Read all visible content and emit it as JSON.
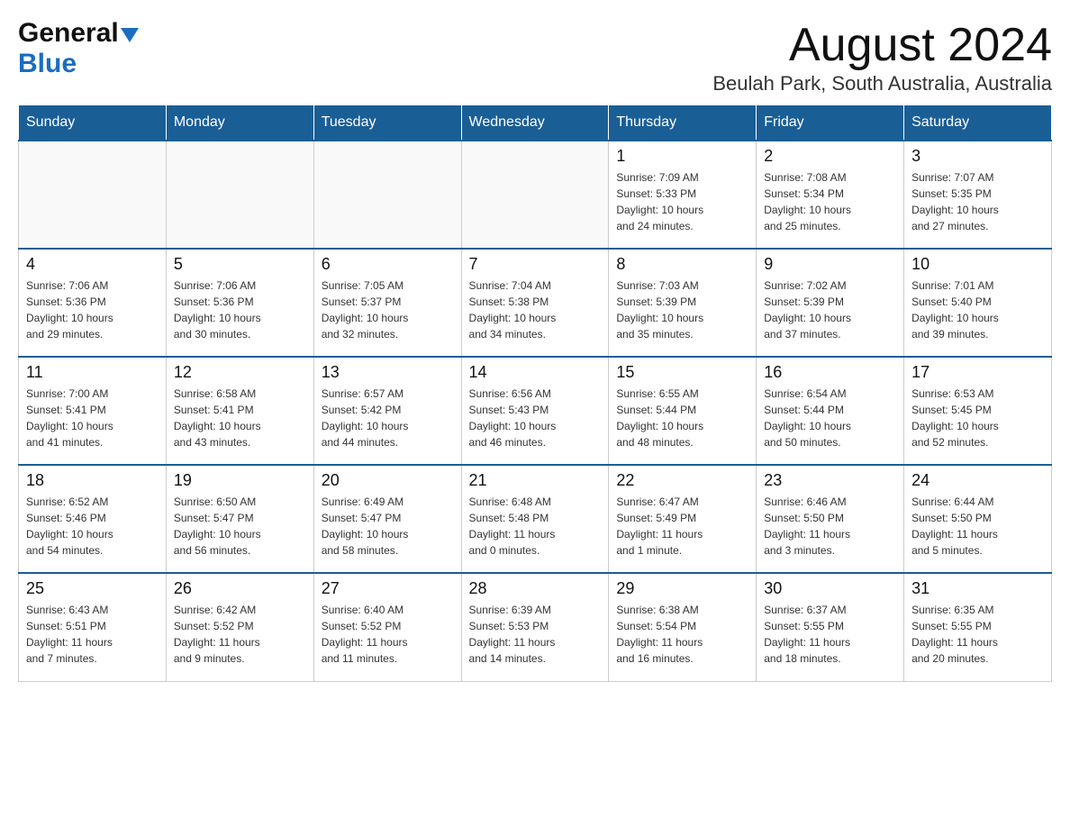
{
  "header": {
    "logo_general": "General",
    "logo_blue": "Blue",
    "title": "August 2024",
    "subtitle": "Beulah Park, South Australia, Australia"
  },
  "days_of_week": [
    "Sunday",
    "Monday",
    "Tuesday",
    "Wednesday",
    "Thursday",
    "Friday",
    "Saturday"
  ],
  "weeks": [
    {
      "cells": [
        {
          "day": "",
          "info": ""
        },
        {
          "day": "",
          "info": ""
        },
        {
          "day": "",
          "info": ""
        },
        {
          "day": "",
          "info": ""
        },
        {
          "day": "1",
          "info": "Sunrise: 7:09 AM\nSunset: 5:33 PM\nDaylight: 10 hours\nand 24 minutes."
        },
        {
          "day": "2",
          "info": "Sunrise: 7:08 AM\nSunset: 5:34 PM\nDaylight: 10 hours\nand 25 minutes."
        },
        {
          "day": "3",
          "info": "Sunrise: 7:07 AM\nSunset: 5:35 PM\nDaylight: 10 hours\nand 27 minutes."
        }
      ]
    },
    {
      "cells": [
        {
          "day": "4",
          "info": "Sunrise: 7:06 AM\nSunset: 5:36 PM\nDaylight: 10 hours\nand 29 minutes."
        },
        {
          "day": "5",
          "info": "Sunrise: 7:06 AM\nSunset: 5:36 PM\nDaylight: 10 hours\nand 30 minutes."
        },
        {
          "day": "6",
          "info": "Sunrise: 7:05 AM\nSunset: 5:37 PM\nDaylight: 10 hours\nand 32 minutes."
        },
        {
          "day": "7",
          "info": "Sunrise: 7:04 AM\nSunset: 5:38 PM\nDaylight: 10 hours\nand 34 minutes."
        },
        {
          "day": "8",
          "info": "Sunrise: 7:03 AM\nSunset: 5:39 PM\nDaylight: 10 hours\nand 35 minutes."
        },
        {
          "day": "9",
          "info": "Sunrise: 7:02 AM\nSunset: 5:39 PM\nDaylight: 10 hours\nand 37 minutes."
        },
        {
          "day": "10",
          "info": "Sunrise: 7:01 AM\nSunset: 5:40 PM\nDaylight: 10 hours\nand 39 minutes."
        }
      ]
    },
    {
      "cells": [
        {
          "day": "11",
          "info": "Sunrise: 7:00 AM\nSunset: 5:41 PM\nDaylight: 10 hours\nand 41 minutes."
        },
        {
          "day": "12",
          "info": "Sunrise: 6:58 AM\nSunset: 5:41 PM\nDaylight: 10 hours\nand 43 minutes."
        },
        {
          "day": "13",
          "info": "Sunrise: 6:57 AM\nSunset: 5:42 PM\nDaylight: 10 hours\nand 44 minutes."
        },
        {
          "day": "14",
          "info": "Sunrise: 6:56 AM\nSunset: 5:43 PM\nDaylight: 10 hours\nand 46 minutes."
        },
        {
          "day": "15",
          "info": "Sunrise: 6:55 AM\nSunset: 5:44 PM\nDaylight: 10 hours\nand 48 minutes."
        },
        {
          "day": "16",
          "info": "Sunrise: 6:54 AM\nSunset: 5:44 PM\nDaylight: 10 hours\nand 50 minutes."
        },
        {
          "day": "17",
          "info": "Sunrise: 6:53 AM\nSunset: 5:45 PM\nDaylight: 10 hours\nand 52 minutes."
        }
      ]
    },
    {
      "cells": [
        {
          "day": "18",
          "info": "Sunrise: 6:52 AM\nSunset: 5:46 PM\nDaylight: 10 hours\nand 54 minutes."
        },
        {
          "day": "19",
          "info": "Sunrise: 6:50 AM\nSunset: 5:47 PM\nDaylight: 10 hours\nand 56 minutes."
        },
        {
          "day": "20",
          "info": "Sunrise: 6:49 AM\nSunset: 5:47 PM\nDaylight: 10 hours\nand 58 minutes."
        },
        {
          "day": "21",
          "info": "Sunrise: 6:48 AM\nSunset: 5:48 PM\nDaylight: 11 hours\nand 0 minutes."
        },
        {
          "day": "22",
          "info": "Sunrise: 6:47 AM\nSunset: 5:49 PM\nDaylight: 11 hours\nand 1 minute."
        },
        {
          "day": "23",
          "info": "Sunrise: 6:46 AM\nSunset: 5:50 PM\nDaylight: 11 hours\nand 3 minutes."
        },
        {
          "day": "24",
          "info": "Sunrise: 6:44 AM\nSunset: 5:50 PM\nDaylight: 11 hours\nand 5 minutes."
        }
      ]
    },
    {
      "cells": [
        {
          "day": "25",
          "info": "Sunrise: 6:43 AM\nSunset: 5:51 PM\nDaylight: 11 hours\nand 7 minutes."
        },
        {
          "day": "26",
          "info": "Sunrise: 6:42 AM\nSunset: 5:52 PM\nDaylight: 11 hours\nand 9 minutes."
        },
        {
          "day": "27",
          "info": "Sunrise: 6:40 AM\nSunset: 5:52 PM\nDaylight: 11 hours\nand 11 minutes."
        },
        {
          "day": "28",
          "info": "Sunrise: 6:39 AM\nSunset: 5:53 PM\nDaylight: 11 hours\nand 14 minutes."
        },
        {
          "day": "29",
          "info": "Sunrise: 6:38 AM\nSunset: 5:54 PM\nDaylight: 11 hours\nand 16 minutes."
        },
        {
          "day": "30",
          "info": "Sunrise: 6:37 AM\nSunset: 5:55 PM\nDaylight: 11 hours\nand 18 minutes."
        },
        {
          "day": "31",
          "info": "Sunrise: 6:35 AM\nSunset: 5:55 PM\nDaylight: 11 hours\nand 20 minutes."
        }
      ]
    }
  ]
}
